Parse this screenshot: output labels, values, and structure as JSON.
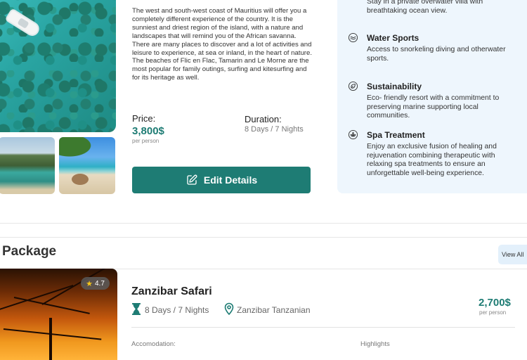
{
  "details": {
    "description": "The west and south-west coast of Mauritius will offer you a completely different experience of the country. It is the sunniest and driest region of the island, with a nature and landscapes that will remind you of the African savanna. There are many places to discover and a lot of activities and leisure to experience, at sea or inland, in the heart of nature. The beaches of Flic en Flac, Tamarin and Le Morne are the most popular for family outings, surfing and kitesurfing and for its heritage as well.",
    "price_label": "Price:",
    "price_value": "3,800$",
    "price_unit": "per person",
    "duration_label": "Duration:",
    "duration_value": "8 Days / 7 Nights",
    "edit_button": "Edit Details"
  },
  "amenities": [
    {
      "title": "",
      "text": "Stay in a private overwater villa with breathtaking ocean view.",
      "icon": "villa-icon"
    },
    {
      "title": "Water Sports",
      "text": "Access to snorkeling diving and otherwater sports.",
      "icon": "water-sports-icon"
    },
    {
      "title": "Sustainability",
      "text": "Eco- friendly resort with a commitment to preserving marine supporting local communities.",
      "icon": "sustainability-icon"
    },
    {
      "title": "Spa Treatment",
      "text": "Enjoy an exclusive fusion of healing and rejuvenation combining therapeutic with relaxing spa treatments to ensure an unforgettable well-being experience.",
      "icon": "spa-icon"
    }
  ],
  "package": {
    "title": "Package",
    "view_all": "View All",
    "cards": [
      {
        "rating": "4.7",
        "title": "Zanzibar Safari",
        "duration": "8 Days / 7 Nights",
        "location": "Zanzibar Tanzanian",
        "price": "2,700$",
        "price_unit": "per person",
        "accommodation_label": "Accomodation:",
        "highlights_label": "Highlights"
      }
    ]
  },
  "colors": {
    "accent": "#1e7c74",
    "panel_bg": "#eef6fd",
    "view_all_bg": "#e3f0fb"
  }
}
